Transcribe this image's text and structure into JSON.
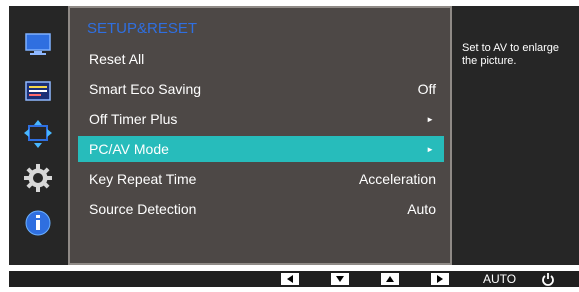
{
  "menu": {
    "title": "SETUP&RESET",
    "items": [
      {
        "label": "Reset All",
        "value": ""
      },
      {
        "label": "Smart Eco Saving",
        "value": "Off"
      },
      {
        "label": "Off Timer Plus",
        "value": "►"
      },
      {
        "label": "PC/AV Mode",
        "value": "►"
      },
      {
        "label": "Key Repeat Time",
        "value": "Acceleration"
      },
      {
        "label": "Source Detection",
        "value": "Auto"
      }
    ],
    "selected_index": 3
  },
  "help_text": "Set to AV to enlarge the picture.",
  "sidebar": {
    "icons": [
      "monitor-icon",
      "display-adjust-icon",
      "size-position-icon",
      "gear-icon",
      "info-icon"
    ],
    "accent_color": "#2f6fe0"
  },
  "bottom_bar": {
    "buttons": [
      "left-arrow-icon",
      "down-arrow-icon",
      "up-arrow-icon",
      "right-arrow-icon"
    ],
    "auto_label": "AUTO",
    "power_icon": "power-icon"
  },
  "colors": {
    "selection": "#27bcbb",
    "panel": "#4d4846",
    "background": "#262626"
  }
}
